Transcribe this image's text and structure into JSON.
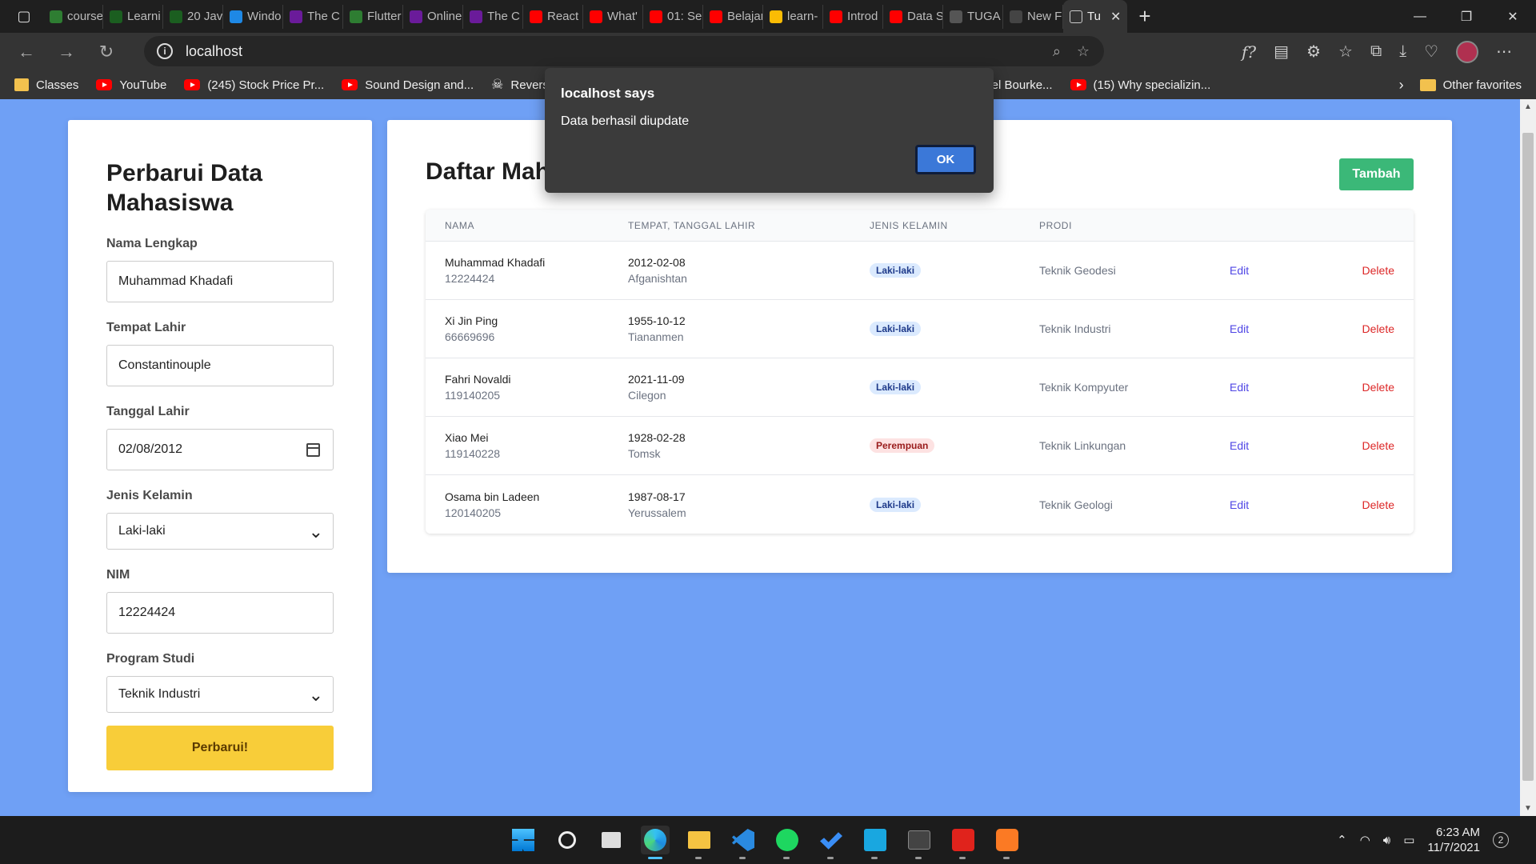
{
  "browser": {
    "tabs": [
      {
        "label": "course",
        "color": "#2e7d32"
      },
      {
        "label": "Learni",
        "color": "#1b5e20"
      },
      {
        "label": "20 Jav",
        "color": "#1b5e20"
      },
      {
        "label": "Windo",
        "color": "#1e88e5"
      },
      {
        "label": "The C",
        "color": "#6a1b9a"
      },
      {
        "label": "Flutter",
        "color": "#2e7d32"
      },
      {
        "label": "Online",
        "color": "#6a1b9a"
      },
      {
        "label": "The C",
        "color": "#6a1b9a"
      },
      {
        "label": "React",
        "color": "#ff0000"
      },
      {
        "label": "What'",
        "color": "#ff0000"
      },
      {
        "label": "01: Se",
        "color": "#ff0000"
      },
      {
        "label": "Belajar",
        "color": "#ff0000"
      },
      {
        "label": "learn-",
        "color": "#fbbc04"
      },
      {
        "label": "Introd",
        "color": "#ff0000"
      },
      {
        "label": "Data S",
        "color": "#ff0000"
      },
      {
        "label": "TUGA",
        "color": "#555555"
      },
      {
        "label": "New F",
        "color": "#444444"
      }
    ],
    "active_tab": "Tu",
    "url": "localhost",
    "bookmarks": [
      {
        "label": "Classes",
        "type": "classroom"
      },
      {
        "label": "YouTube",
        "type": "yt"
      },
      {
        "label": "(245) Stock Price Pr...",
        "type": "yt"
      },
      {
        "label": "Sound Design and...",
        "type": "yt"
      },
      {
        "label": "Reverse S",
        "type": "skull"
      }
    ],
    "bookmarks_right": [
      {
        "label": "niel Bourke...",
        "type": "plain"
      },
      {
        "label": "(15) Why specializin...",
        "type": "yt"
      }
    ],
    "other_favorites": "Other favorites",
    "extensions_text": "f?"
  },
  "form": {
    "title": "Perbarui Data Mahasiswa",
    "fields": [
      {
        "label": "Nama Lengkap",
        "value": "Muhammad Khadafi",
        "kind": "text"
      },
      {
        "label": "Tempat Lahir",
        "value": "Constantinouple",
        "kind": "text"
      },
      {
        "label": "Tanggal Lahir",
        "value": "02/08/2012",
        "kind": "date"
      },
      {
        "label": "Jenis Kelamin",
        "value": "Laki-laki",
        "kind": "select"
      },
      {
        "label": "NIM",
        "value": "12224424",
        "kind": "text"
      },
      {
        "label": "Program Studi",
        "value": "Teknik Industri",
        "kind": "select"
      }
    ],
    "submit_label": "Perbarui!"
  },
  "list": {
    "title": "Daftar Mahasiswa",
    "add_label": "Tambah",
    "headers": [
      "NAMA",
      "TEMPAT, TANGGAL LAHIR",
      "JENIS KELAMIN",
      "PRODI"
    ],
    "edit_label": "Edit",
    "delete_label": "Delete",
    "rows": [
      {
        "nama": "Muhammad Khadafi",
        "nim": "12224424",
        "tanggal": "2012-02-08",
        "tempat": "Afganishtan",
        "jk": "Laki-laki",
        "prodi": "Teknik Geodesi"
      },
      {
        "nama": "Xi Jin Ping",
        "nim": "66669696",
        "tanggal": "1955-10-12",
        "tempat": "Tiananmen",
        "jk": "Laki-laki",
        "prodi": "Teknik Industri"
      },
      {
        "nama": "Fahri Novaldi",
        "nim": "119140205",
        "tanggal": "2021-11-09",
        "tempat": "Cilegon",
        "jk": "Laki-laki",
        "prodi": "Teknik Kompyuter"
      },
      {
        "nama": "Xiao Mei",
        "nim": "119140228",
        "tanggal": "1928-02-28",
        "tempat": "Tomsk",
        "jk": "Perempuan",
        "prodi": "Teknik Linkungan"
      },
      {
        "nama": "Osama bin Ladeen",
        "nim": "120140205",
        "tanggal": "1987-08-17",
        "tempat": "Yerussalem",
        "jk": "Laki-laki",
        "prodi": "Teknik Geologi"
      }
    ]
  },
  "dialog": {
    "title": "localhost says",
    "message": "Data berhasil diupdate",
    "ok_label": "OK"
  },
  "taskbar": {
    "apps": [
      "windows-start",
      "search",
      "task-view",
      "edge",
      "file-explorer",
      "vscode",
      "spotify",
      "todo",
      "launcher-l",
      "terminal",
      "acrobat",
      "xampp"
    ],
    "time": "6:23 AM",
    "date": "11/7/2021",
    "notifications": "2"
  },
  "colors": {
    "page_bg": "#6fa0f5",
    "submit": "#f8cd39",
    "add": "#3bb878",
    "edit": "#4f46e5",
    "delete": "#dc2626"
  }
}
